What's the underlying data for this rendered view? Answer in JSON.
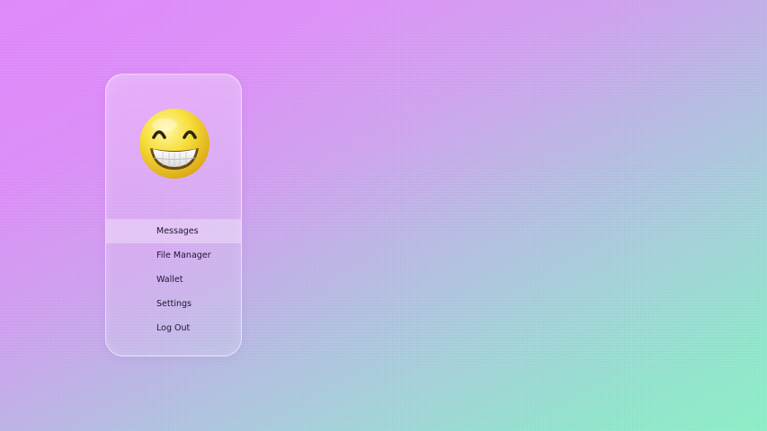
{
  "profile": {
    "avatar_icon": "grinning-face-emoji"
  },
  "menu": {
    "active_index": 0,
    "items": [
      {
        "label": "Messages"
      },
      {
        "label": "File Manager"
      },
      {
        "label": "Wallet"
      },
      {
        "label": "Settings"
      },
      {
        "label": "Log Out"
      }
    ]
  },
  "colors": {
    "background_top": "#e08bfb",
    "background_bottom": "#8ff0c8",
    "text": "#1f1530",
    "emoji_yellow": "#f7df3c"
  }
}
